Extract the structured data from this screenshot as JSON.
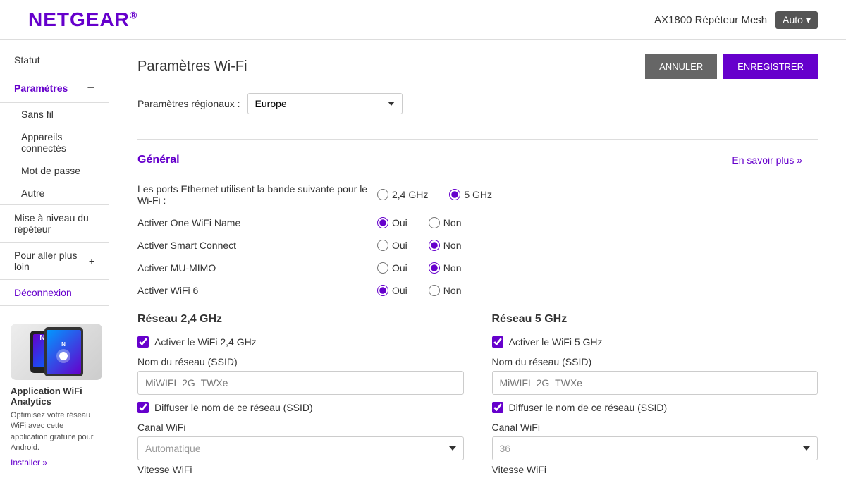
{
  "header": {
    "logo": "NETGEAR",
    "logo_reg": "®",
    "device": "AX1800 Répéteur Mesh",
    "auto_label": "Auto"
  },
  "sidebar": {
    "statut_label": "Statut",
    "parametres_label": "Paramètres",
    "sans_fil_label": "Sans fil",
    "appareils_label": "Appareils connectés",
    "mot_de_passe_label": "Mot de passe",
    "autre_label": "Autre",
    "mise_a_niveau_label": "Mise à niveau du répéteur",
    "pour_aller_label": "Pour aller plus loin",
    "deconnexion_label": "Déconnexion",
    "app_title": "Application WiFi Analytics",
    "app_desc": "Optimisez votre réseau WiFi avec cette application gratuite pour Android.",
    "install_label": "Installer »"
  },
  "main": {
    "page_title": "Paramètres Wi-Fi",
    "cancel_label": "ANNULER",
    "save_label": "ENREGISTRER",
    "regional_label": "Paramètres régionaux :",
    "regional_value": "Europe",
    "general_title": "Général",
    "learn_more_label": "En savoir plus »",
    "ethernet_label": "Les ports Ethernet utilisent la bande suivante pour le Wi-Fi :",
    "band_24_label": "2,4 GHz",
    "band_5_label": "5 GHz",
    "one_wifi_label": "Activer One WiFi Name",
    "smart_connect_label": "Activer Smart Connect",
    "mu_mimo_label": "Activer MU-MIMO",
    "wifi6_label": "Activer WiFi 6",
    "oui_label": "Oui",
    "non_label": "Non",
    "reseau_24_title": "Réseau 2,4 GHz",
    "reseau_5_title": "Réseau 5 GHz",
    "activer_wifi_24_label": "Activer le WiFi 2,4 GHz",
    "activer_wifi_5_label": "Activer le WiFi 5 GHz",
    "nom_reseau_label": "Nom du réseau (SSID)",
    "ssid_placeholder_24": "MiWIFI_2G_TWXe",
    "ssid_placeholder_5": "MiWIFI_2G_TWXe",
    "diffuser_label": "Diffuser le nom de ce réseau (SSID)",
    "canal_wifi_label": "Canal WiFi",
    "canal_auto_label": "Automatique",
    "canal_36_label": "36",
    "vitesse_wifi_label": "Vitesse WiFi",
    "ethernet_band_selected": "5",
    "one_wifi_selected": "oui",
    "smart_connect_selected": "non",
    "mu_mimo_selected": "non",
    "wifi6_selected": "oui"
  }
}
